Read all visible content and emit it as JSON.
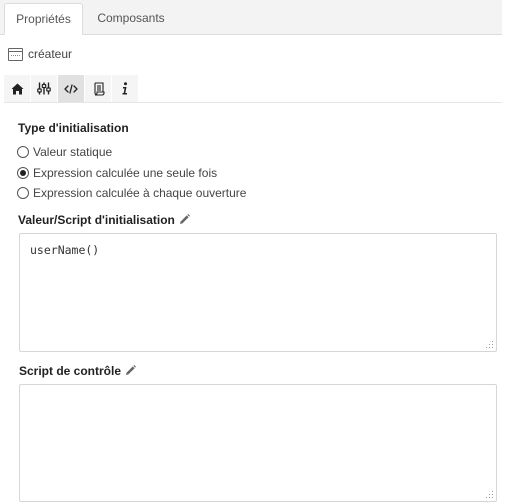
{
  "tabs": [
    {
      "label": "Propriétés",
      "active": true
    },
    {
      "label": "Composants",
      "active": false
    }
  ],
  "component": {
    "icon": "window-icon",
    "name": "créateur"
  },
  "toolbar": {
    "items": [
      {
        "icon": "home-icon",
        "active": false
      },
      {
        "icon": "sliders-icon",
        "active": false
      },
      {
        "icon": "code-icon",
        "active": true
      },
      {
        "icon": "script-icon",
        "active": false
      },
      {
        "icon": "info-icon",
        "active": false
      }
    ]
  },
  "init_type": {
    "label": "Type d'initialisation",
    "options": [
      {
        "label": "Valeur statique",
        "checked": false
      },
      {
        "label": "Expression calculée une seule fois",
        "checked": true
      },
      {
        "label": "Expression calculée à chaque ouverture",
        "checked": false
      }
    ]
  },
  "init_script": {
    "label": "Valeur/Script d'initialisation",
    "value": "userName()"
  },
  "control_script": {
    "label": "Script de contrôle",
    "value": ""
  }
}
